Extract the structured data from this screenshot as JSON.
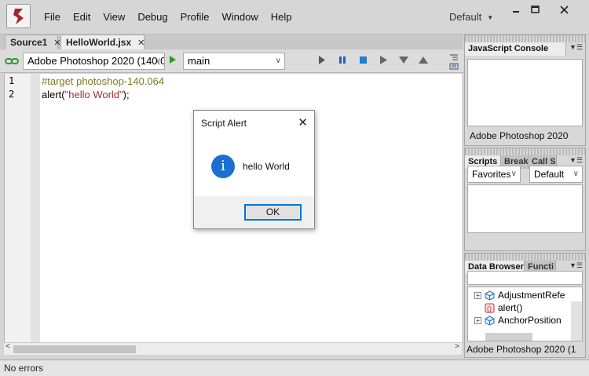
{
  "menu": [
    "File",
    "Edit",
    "View",
    "Debug",
    "Profile",
    "Window",
    "Help"
  ],
  "workspace": "Default",
  "tabs": [
    {
      "label": "Source1"
    },
    {
      "label": "HelloWorld.jsx"
    }
  ],
  "toolbar": {
    "target_app": "Adobe Photoshop 2020 (140.0",
    "function": "main"
  },
  "editor": {
    "lines": [
      {
        "num": "1",
        "text": "#target photoshop-140.064"
      },
      {
        "num": "2",
        "pre": "alert(",
        "str": "\"hello World\"",
        "post": ");"
      }
    ]
  },
  "status": "No errors",
  "panels": {
    "console": {
      "tab": "JavaScript Console",
      "target": "Adobe Photoshop 2020"
    },
    "scripts": {
      "tabs": [
        "Scripts",
        "Break",
        "Call S"
      ],
      "favorites": "Favorites",
      "scope": "Default"
    },
    "data": {
      "tabs": [
        "Data Browser",
        "Functi"
      ],
      "items": [
        "AdjustmentRefe",
        "alert()",
        "AnchorPosition"
      ],
      "target": "Adobe Photoshop 2020 (1"
    }
  },
  "dialog": {
    "title": "Script Alert",
    "message": "hello World",
    "ok": "OK"
  },
  "colors": {
    "accent": "#0078d7",
    "info_icon": "#1a6fd1",
    "play_green": "#2c9a2c",
    "string": "#9a2f2f",
    "directive": "#7c7c20"
  }
}
